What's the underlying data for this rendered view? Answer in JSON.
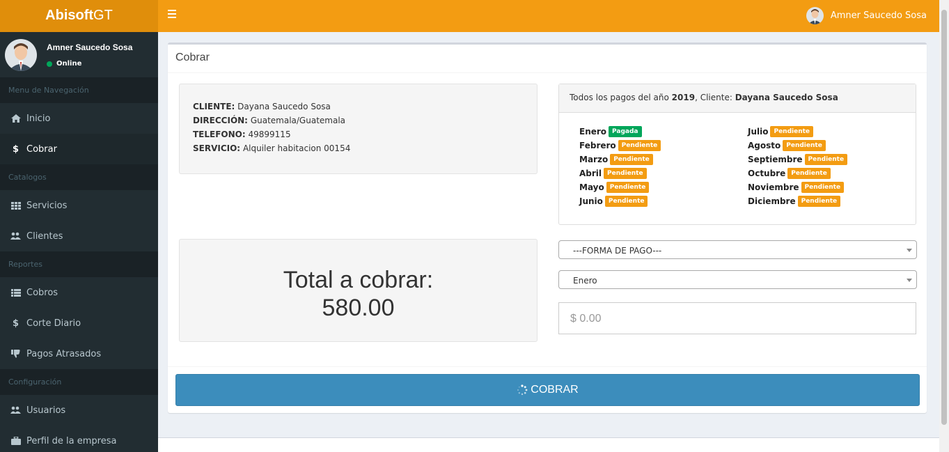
{
  "brand": {
    "bold": "Abisoft",
    "light": "GT"
  },
  "topbar": {
    "user_name": "Amner Saucedo Sosa"
  },
  "sidebar": {
    "user_name": "Amner Saucedo Sosa",
    "status": "Online",
    "sections": [
      {
        "header": "Menu de Navegación",
        "items": [
          {
            "label": "Inicio",
            "icon": "home-icon"
          },
          {
            "label": "Cobrar",
            "icon": "dollar-icon",
            "active": true
          }
        ]
      },
      {
        "header": "Catalogos",
        "items": [
          {
            "label": "Servicios",
            "icon": "grid-icon"
          },
          {
            "label": "Clientes",
            "icon": "users-icon"
          }
        ]
      },
      {
        "header": "Reportes",
        "items": [
          {
            "label": "Cobros",
            "icon": "list-icon"
          },
          {
            "label": "Corte Diario",
            "icon": "dollar-icon"
          },
          {
            "label": "Pagos Atrasados",
            "icon": "thumbs-down-icon"
          }
        ]
      },
      {
        "header": "Configuración",
        "items": [
          {
            "label": "Usuarios",
            "icon": "users-icon"
          },
          {
            "label": "Perfil de la empresa",
            "icon": "briefcase-icon"
          }
        ]
      }
    ]
  },
  "main": {
    "title": "Cobrar",
    "client": {
      "cliente_label": "CLIENTE:",
      "cliente": "Dayana Saucedo Sosa",
      "direccion_label": "DIRECCIÓN:",
      "direccion": "Guatemala/Guatemala",
      "telefono_label": "TELEFONO:",
      "telefono": "49899115",
      "servicio_label": "SERVICIO:",
      "servicio": "Alquiler habitacion 00154"
    },
    "payments": {
      "prefix": "Todos los pagos del año ",
      "year": "2019",
      "middle": ", Cliente: ",
      "client": "Dayana Saucedo Sosa",
      "months": [
        {
          "name": "Enero",
          "status": "Pagada"
        },
        {
          "name": "Febrero",
          "status": "Pendiente"
        },
        {
          "name": "Marzo",
          "status": "Pendiente"
        },
        {
          "name": "Abril",
          "status": "Pendiente"
        },
        {
          "name": "Mayo",
          "status": "Pendiente"
        },
        {
          "name": "Junio",
          "status": "Pendiente"
        },
        {
          "name": "Julio",
          "status": "Pendiente"
        },
        {
          "name": "Agosto",
          "status": "Pendiente"
        },
        {
          "name": "Septiembre",
          "status": "Pendiente"
        },
        {
          "name": "Octubre",
          "status": "Pendiente"
        },
        {
          "name": "Noviembre",
          "status": "Pendiente"
        },
        {
          "name": "Diciembre",
          "status": "Pendiente"
        }
      ]
    },
    "total_label": "Total a cobrar:",
    "total_value": "580.00",
    "forma_pago": "---FORMA DE PAGO---",
    "mes_select": "Enero",
    "amount_placeholder": "$ 0.00",
    "cobrar_label": "COBRAR"
  },
  "colors": {
    "accent": "#f39c12",
    "primary": "#3c8dbc",
    "success": "#00a65a",
    "sidebar": "#222d32"
  }
}
